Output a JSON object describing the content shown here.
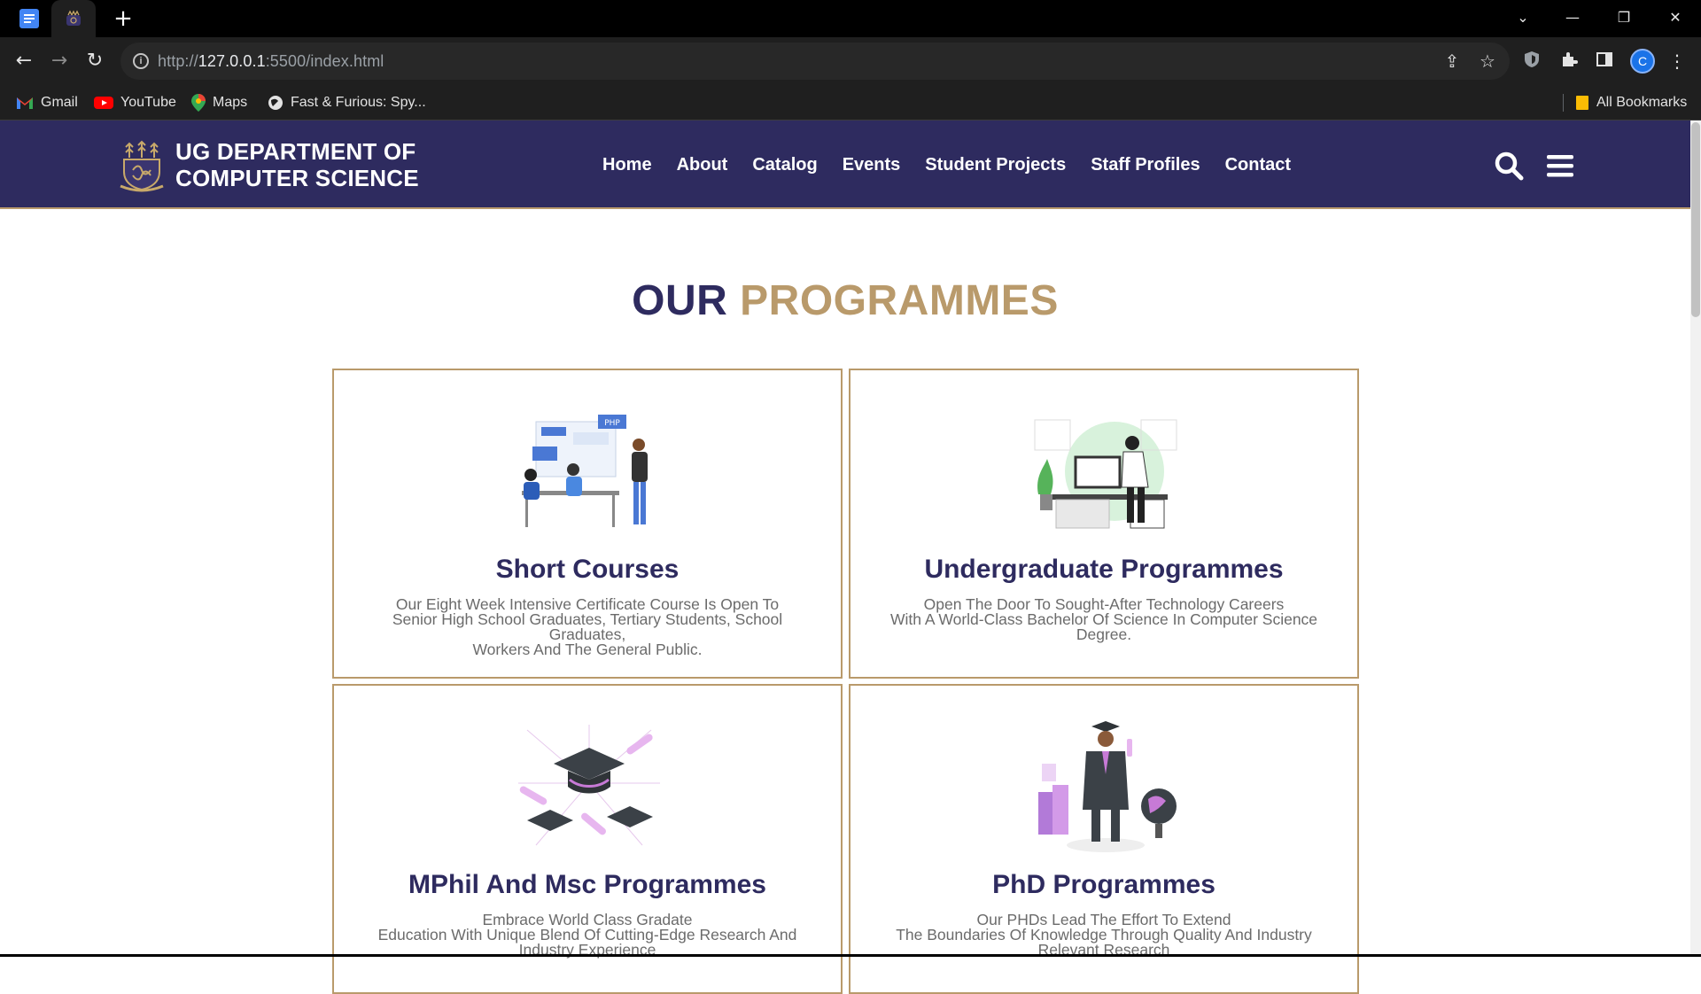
{
  "browser": {
    "url_prefix": "http://",
    "url_host": "127.0.0.1",
    "url_rest": ":5500/index.html",
    "bookmarks": [
      {
        "label": "Gmail"
      },
      {
        "label": "YouTube"
      },
      {
        "label": "Maps"
      },
      {
        "label": "Fast & Furious: Spy..."
      }
    ],
    "all_bookmarks_label": "All Bookmarks",
    "avatar_letter": "C"
  },
  "header": {
    "brand_line1": "UG DEPARTMENT OF",
    "brand_line2": "COMPUTER SCIENCE",
    "nav": [
      "Home",
      "About",
      "Catalog",
      "Events",
      "Student Projects",
      "Staff Profiles",
      "Contact"
    ]
  },
  "main": {
    "title_part1": "OUR",
    "title_part2": "PROGRAMMES",
    "cards": [
      {
        "title": "Short Courses",
        "desc": [
          "Our Eight Week Intensive Certificate Course Is Open To",
          "Senior High School Graduates, Tertiary Students, School Graduates,",
          "Workers And The General Public."
        ]
      },
      {
        "title": "Undergraduate Programmes",
        "desc": [
          "Open The Door To Sought-After Technology Careers",
          "With A World-Class Bachelor Of Science In Computer Science",
          "Degree."
        ]
      },
      {
        "title": "MPhil And Msc Programmes",
        "desc": [
          "Embrace World Class Gradate",
          "Education With Unique Blend Of Cutting-Edge Research And",
          "Industry Experience"
        ]
      },
      {
        "title": "PhD Programmes",
        "desc": [
          "Our PHDs Lead The Effort To Extend",
          "The Boundaries Of Knowledge Through Quality And Industry",
          "Relevant Research"
        ]
      }
    ]
  },
  "colors": {
    "header_bg": "#2e2b5f",
    "accent_gold": "#b99a6b",
    "title_navy": "#2e2b5f"
  }
}
